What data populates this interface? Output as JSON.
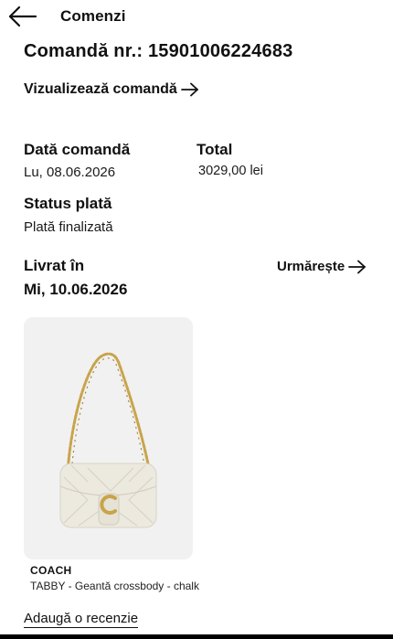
{
  "header": {
    "title": "Comenzi",
    "back_icon": "arrow-left-icon"
  },
  "order": {
    "number_text": "Comandă nr.: 15901006224683",
    "view_link": "Vizualizează comandă",
    "view_link_icon": "arrow-right-icon",
    "date_label": "Dată comandă",
    "date_value": "Lu, 08.06.2026",
    "total_label": "Total",
    "total_value": "3029,00 lei",
    "payment_status_label": "Status plată",
    "payment_status_value": "Plată finalizată",
    "delivered_label": "Livrat în",
    "delivered_date": "Mi, 10.06.2026",
    "track_link": "Urmărește",
    "track_link_icon": "arrow-right-icon"
  },
  "product": {
    "image_icon": "handbag-image",
    "brand": "COACH",
    "name": "TABBY - Geantă crossbody - chalk"
  },
  "review_link": "Adaugă o recenzie",
  "colors": {
    "text": "#111111",
    "card_background": "#f1f1f1",
    "bag": "#ece9df",
    "hardware": "#c8a44a"
  }
}
